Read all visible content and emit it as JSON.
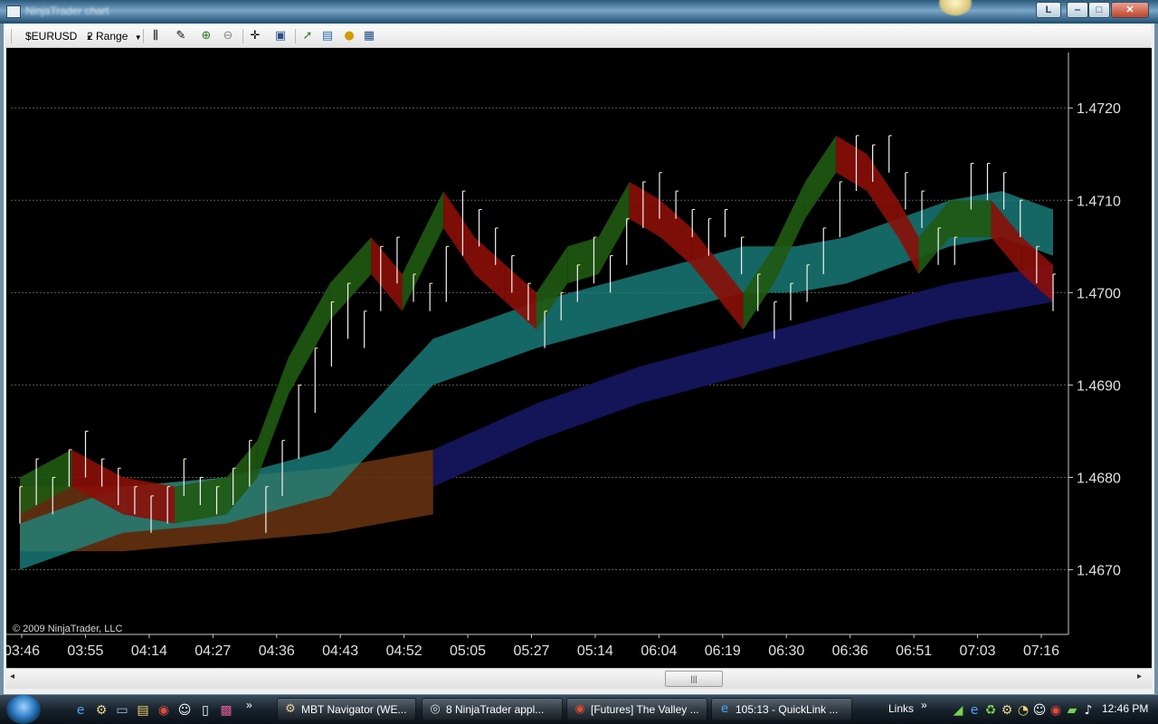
{
  "window": {
    "title": "NinjaTrader chart",
    "buttons": {
      "help": "L",
      "minimize": "‒",
      "maximize": "□",
      "close": "✕"
    }
  },
  "toolbar": {
    "instrument": "$EURUSD",
    "period": "2 Range",
    "icons": [
      "bar-style-icon",
      "draw-pencil-icon",
      "zoom-in-icon",
      "zoom-out-icon",
      "crosshair-icon",
      "properties-icon",
      "indicators-icon",
      "strategy-icon",
      "chart-trader-icon",
      "data-box-icon"
    ]
  },
  "chart": {
    "copyright": "© 2009 NinjaTrader, LLC",
    "colors": {
      "background": "#000000",
      "grid": "#5a5a5a",
      "up_band": "#1f5a12",
      "down_band": "#8b0e08",
      "teal_band": "#1b8a86",
      "blue_band": "#15155e",
      "orange_band": "#6b3510",
      "bars": "#f2f2f2",
      "bar_highlight": "#ffff88"
    },
    "price_labels": [
      "1.4720",
      "1.4710",
      "1.4700",
      "1.4690",
      "1.4680",
      "1.4670"
    ],
    "time_labels": [
      "03:46",
      "03:55",
      "04:14",
      "04:27",
      "04:36",
      "04:43",
      "04:52",
      "05:05",
      "05:27",
      "05:14",
      "06:04",
      "06:19",
      "06:30",
      "06:36",
      "06:51",
      "07:03",
      "07:16"
    ],
    "price_range": [
      1.4663,
      1.4726
    ],
    "series": {
      "bars": [
        [
          1.4679,
          1.4675
        ],
        [
          1.4682,
          1.4677
        ],
        [
          1.468,
          1.4676
        ],
        [
          1.4683,
          1.4679
        ],
        [
          1.4685,
          1.468
        ],
        [
          1.4682,
          1.4679
        ],
        [
          1.4681,
          1.4677
        ],
        [
          1.4679,
          1.4676
        ],
        [
          1.4678,
          1.4674
        ],
        [
          1.4679,
          1.4675
        ],
        [
          1.4682,
          1.4678
        ],
        [
          1.468,
          1.4677
        ],
        [
          1.4679,
          1.4676
        ],
        [
          1.4681,
          1.4677
        ],
        [
          1.4684,
          1.4679
        ],
        [
          1.4679,
          1.4674
        ],
        [
          1.4684,
          1.4678
        ],
        [
          1.469,
          1.4682
        ],
        [
          1.4694,
          1.4687
        ],
        [
          1.4699,
          1.4692
        ],
        [
          1.4701,
          1.4695
        ],
        [
          1.4698,
          1.4694
        ],
        [
          1.4705,
          1.4698
        ],
        [
          1.4706,
          1.4701
        ],
        [
          1.4702,
          1.4699
        ],
        [
          1.4701,
          1.4698
        ],
        [
          1.4705,
          1.4699
        ],
        [
          1.4711,
          1.4704
        ],
        [
          1.4709,
          1.4705
        ],
        [
          1.4707,
          1.4703
        ],
        [
          1.4704,
          1.47
        ],
        [
          1.4701,
          1.4697
        ],
        [
          1.4698,
          1.4694
        ],
        [
          1.47,
          1.4697
        ],
        [
          1.4703,
          1.4699
        ],
        [
          1.4706,
          1.4701
        ],
        [
          1.4704,
          1.47
        ],
        [
          1.4708,
          1.4703
        ],
        [
          1.4712,
          1.4707
        ],
        [
          1.4713,
          1.4708
        ],
        [
          1.4711,
          1.4708
        ],
        [
          1.4709,
          1.4706
        ],
        [
          1.4708,
          1.4704
        ],
        [
          1.4709,
          1.4706
        ],
        [
          1.4706,
          1.4702
        ],
        [
          1.4702,
          1.4698
        ],
        [
          1.4699,
          1.4695
        ],
        [
          1.4701,
          1.4697
        ],
        [
          1.4703,
          1.4699
        ],
        [
          1.4707,
          1.4702
        ],
        [
          1.4712,
          1.4706
        ],
        [
          1.4717,
          1.4711
        ],
        [
          1.4716,
          1.4712
        ],
        [
          1.4717,
          1.4713
        ],
        [
          1.4713,
          1.4709
        ],
        [
          1.4711,
          1.4707
        ],
        [
          1.4707,
          1.4703
        ],
        [
          1.4706,
          1.4703
        ],
        [
          1.4714,
          1.4709
        ],
        [
          1.4714,
          1.471
        ],
        [
          1.4713,
          1.4709
        ],
        [
          1.471,
          1.4706
        ],
        [
          1.4705,
          1.4701
        ],
        [
          1.4702,
          1.4698
        ]
      ],
      "up_band_upper": [
        [
          0,
          1.468
        ],
        [
          0.05,
          1.4683
        ],
        [
          0.1,
          1.468
        ],
        [
          0.15,
          1.4679
        ],
        [
          0.2,
          1.468
        ],
        [
          0.23,
          1.4684
        ],
        [
          0.26,
          1.4693
        ],
        [
          0.3,
          1.4701
        ],
        [
          0.34,
          1.4706
        ],
        [
          0.37,
          1.4702
        ],
        [
          0.41,
          1.4711
        ],
        [
          0.44,
          1.4706
        ],
        [
          0.47,
          1.4703
        ],
        [
          0.5,
          1.47
        ],
        [
          0.53,
          1.4705
        ],
        [
          0.56,
          1.4706
        ],
        [
          0.59,
          1.4712
        ],
        [
          0.62,
          1.471
        ],
        [
          0.65,
          1.4707
        ],
        [
          0.7,
          1.47
        ],
        [
          0.73,
          1.4705
        ],
        [
          0.76,
          1.4712
        ],
        [
          0.79,
          1.4717
        ],
        [
          0.82,
          1.4715
        ],
        [
          0.85,
          1.471
        ],
        [
          0.87,
          1.4706
        ],
        [
          0.9,
          1.471
        ],
        [
          0.94,
          1.471
        ],
        [
          0.97,
          1.4706
        ],
        [
          1,
          1.4703
        ]
      ],
      "teal_band_upper": [
        [
          0,
          1.4675
        ],
        [
          0.1,
          1.4679
        ],
        [
          0.2,
          1.468
        ],
        [
          0.3,
          1.4683
        ],
        [
          0.4,
          1.4695
        ],
        [
          0.5,
          1.4699
        ],
        [
          0.6,
          1.4702
        ],
        [
          0.7,
          1.4705
        ],
        [
          0.75,
          1.4705
        ],
        [
          0.8,
          1.4706
        ],
        [
          0.85,
          1.4708
        ],
        [
          0.9,
          1.471
        ],
        [
          0.95,
          1.4711
        ],
        [
          1,
          1.4709
        ]
      ],
      "blue_band_upper": [
        [
          0.4,
          1.4683
        ],
        [
          0.5,
          1.4688
        ],
        [
          0.6,
          1.4692
        ],
        [
          0.7,
          1.4695
        ],
        [
          0.8,
          1.4698
        ],
        [
          0.9,
          1.4701
        ],
        [
          1,
          1.4703
        ]
      ],
      "orange_band_upper": [
        [
          0,
          1.4679
        ],
        [
          0.1,
          1.4679
        ],
        [
          0.2,
          1.468
        ],
        [
          0.3,
          1.4681
        ],
        [
          0.4,
          1.4683
        ]
      ]
    }
  },
  "scrollbar": {
    "left_arrow": "◂",
    "right_arrow": "▸",
    "thumb_grip": "|||"
  },
  "taskbar": {
    "quicklaunch_icons": [
      "internet-explorer-icon",
      "mbt-icon",
      "desktop-icon",
      "explorer-icon",
      "chrome-icon",
      "media-icon",
      "notepad-icon",
      "paint-icon"
    ],
    "overflow": "»",
    "tasks": [
      {
        "label": "MBT Navigator (WE...",
        "icon": "mbt-icon"
      },
      {
        "label": "8 NinjaTrader appl...",
        "icon": "ninjatrader-icon"
      },
      {
        "label": "[Futures] The Valley ...",
        "icon": "chrome-icon"
      },
      {
        "label": "105:13 - QuickLink ...",
        "icon": "quicklink-icon"
      }
    ],
    "links": "Links",
    "links_overflow": "»",
    "tray_icons": [
      "network-icon",
      "ie-tray-icon",
      "sync-icon",
      "mbt-tray-icon",
      "clock-app-icon",
      "media-tray-icon",
      "chrome-tray-icon",
      "security-icon",
      "volume-icon"
    ],
    "time": "12:46 PM"
  }
}
